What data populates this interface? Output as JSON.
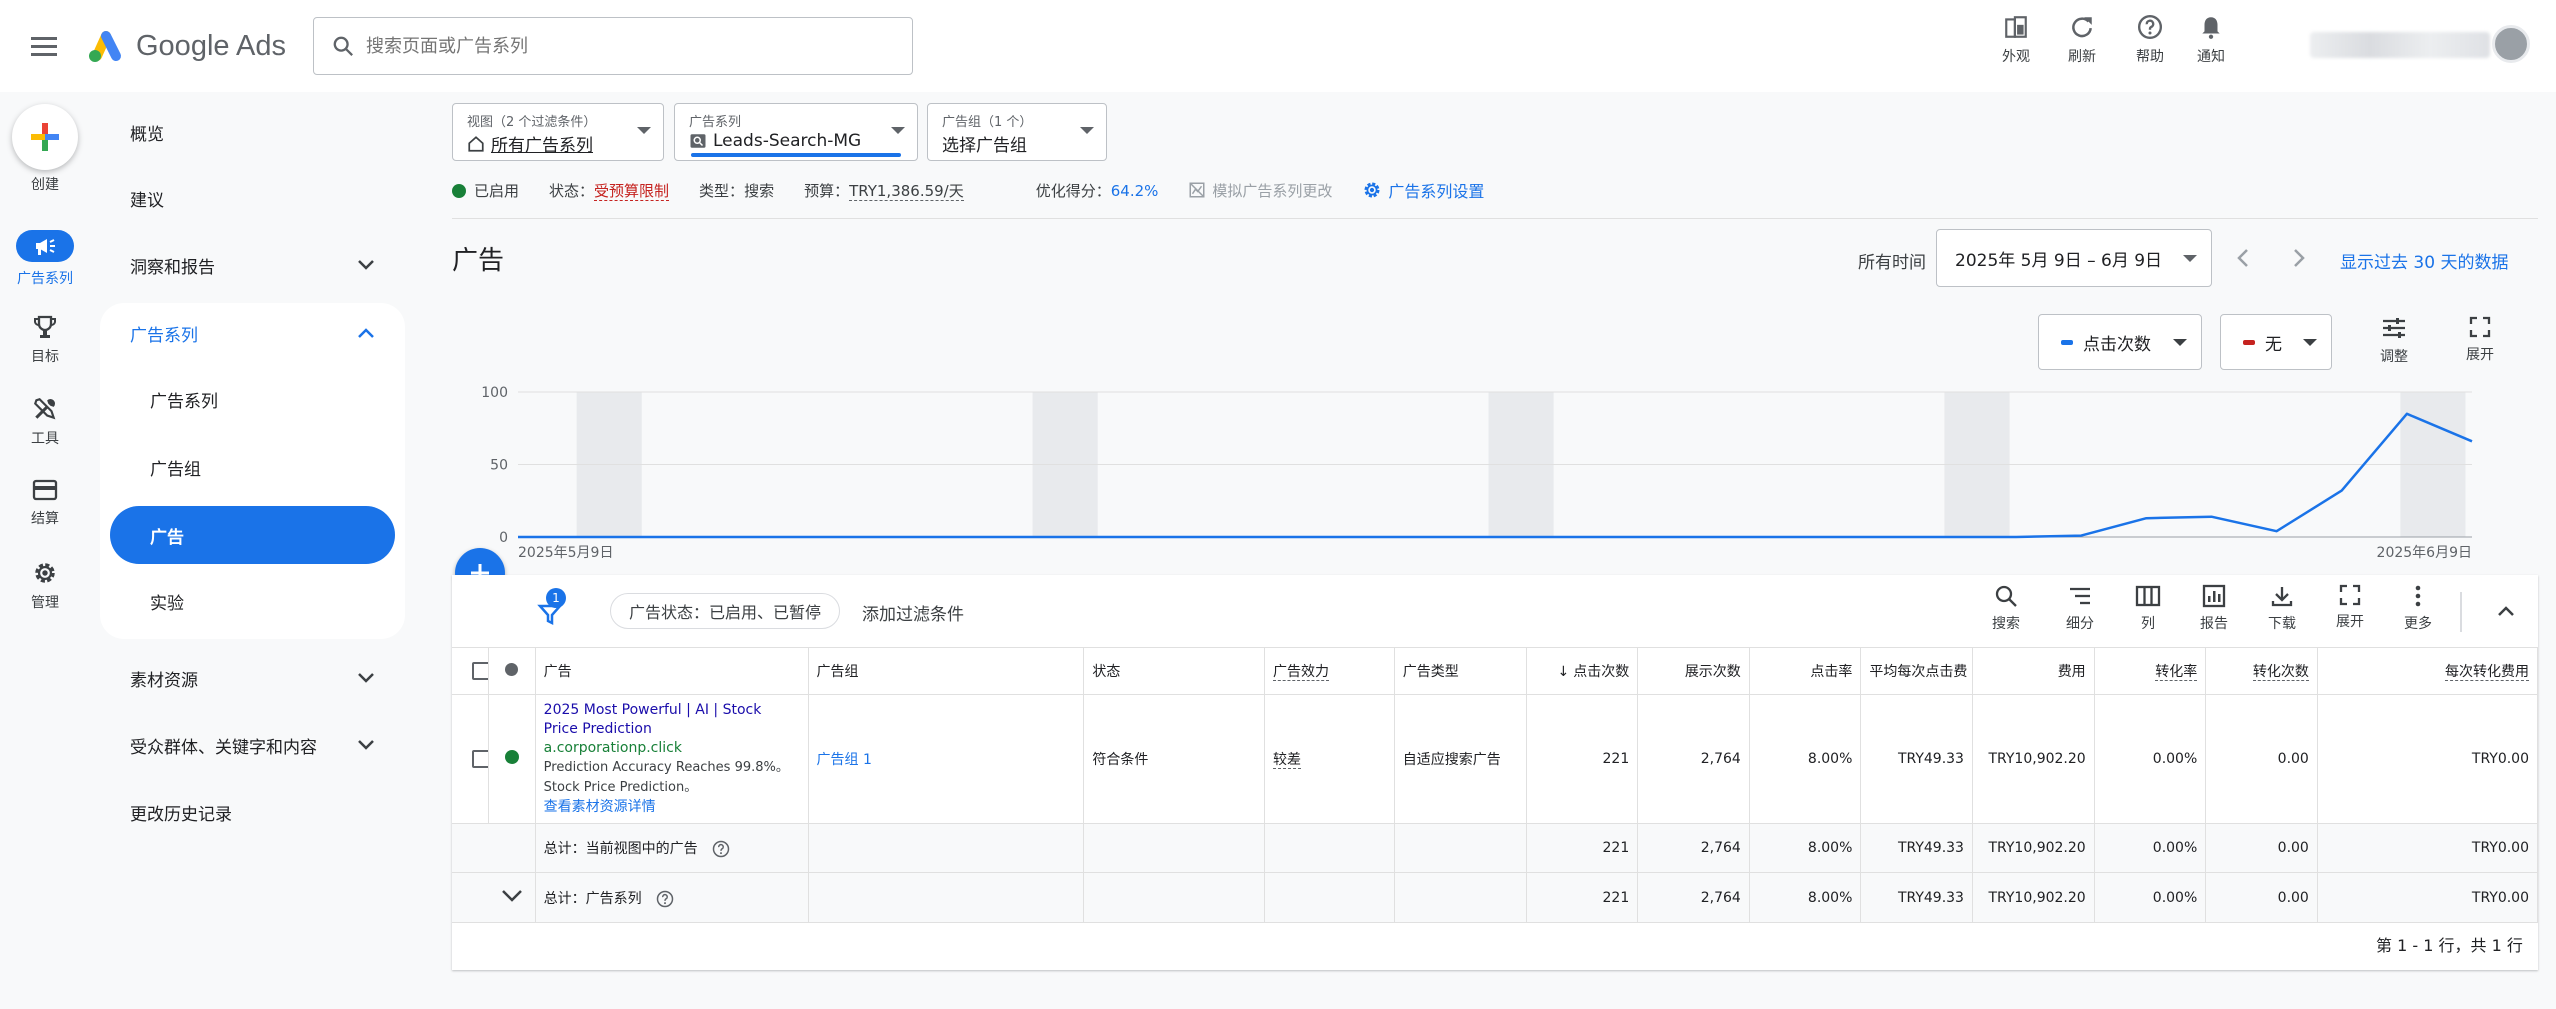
{
  "app": {
    "name": "Google Ads"
  },
  "search": {
    "placeholder": "搜索页面或广告系列"
  },
  "toolbar": {
    "appearance": "外观",
    "refresh": "刷新",
    "help": "帮助",
    "notifications": "通知"
  },
  "rail": {
    "create": "创建",
    "campaigns": "广告系列",
    "goals": "目标",
    "tools": "工具",
    "billing": "结算",
    "admin": "管理"
  },
  "nav": {
    "overview": "概览",
    "recommendations": "建议",
    "insights": "洞察和报告",
    "campaigns_group": "广告系列",
    "sub": {
      "campaigns": "广告系列",
      "ad_groups": "广告组",
      "ads": "广告",
      "experiments": "实验"
    },
    "assets": "素材资源",
    "audiences": "受众群体、关键字和内容",
    "change_history": "更改历史记录"
  },
  "selectors": {
    "view": {
      "label": "视图（2 个过滤条件）",
      "value": "所有广告系列"
    },
    "campaign": {
      "label": "广告系列",
      "value": "Leads-Search-MG"
    },
    "ad_group": {
      "label": "广告组（1 个）",
      "value": "选择广告组"
    }
  },
  "status_row": {
    "enabled": "已启用",
    "status_label": "状态：",
    "status_value": "受预算限制",
    "type_label": "类型：",
    "type_value": "搜索",
    "budget_label": "预算：",
    "budget_value": "TRY1,386.59/天",
    "opt_label": "优化得分：",
    "opt_value": "64.2%",
    "simulate": "模拟广告系列更改",
    "settings": "广告系列设置"
  },
  "page": {
    "title": "广告"
  },
  "date": {
    "all_time": "所有时间",
    "range": "2025年 5月 9日 – 6月 9日",
    "last30": "显示过去 30 天的数据"
  },
  "chart_controls": {
    "metric1": "点击次数",
    "metric2": "无",
    "adjust": "调整",
    "expand": "展开"
  },
  "colors": {
    "metric1": "#1a73e8",
    "metric2": "#c5221f",
    "accent": "#1a73e8"
  },
  "chart_data": {
    "type": "line",
    "series": [
      {
        "values": [
          0,
          0,
          0,
          0,
          0,
          0,
          0,
          0,
          0,
          0,
          0,
          0,
          0,
          0,
          0,
          0,
          0,
          0,
          0,
          0,
          0,
          0,
          0,
          0,
          1,
          13,
          14,
          4,
          32,
          85,
          66
        ]
      }
    ],
    "yticks": [
      0,
      50,
      100
    ],
    "ylim": [
      0,
      100
    ],
    "x_labels": [
      "2025年5月9日",
      "2025年6月9日"
    ],
    "weekend_shading": true
  },
  "table_toolbar": {
    "filter_count": "1",
    "filter_chip": "广告状态：已启用、已暂停",
    "add_filter": "添加过滤条件",
    "search": "搜索",
    "segment": "细分",
    "columns": "列",
    "reports": "报告",
    "download": "下载",
    "expand": "展开",
    "more": "更多"
  },
  "table": {
    "headers": {
      "ad": "广告",
      "ad_group": "广告组",
      "status": "状态",
      "ad_strength": "广告效力",
      "ad_type": "广告类型",
      "clicks": "点击次数",
      "impressions": "展示次数",
      "ctr": "点击率",
      "avg_cpc": "平均每次点击费",
      "cost": "费用",
      "conv_rate": "转化率",
      "conversions": "转化次数",
      "cost_per_conv": "每次转化费用"
    },
    "row": {
      "title": "2025 Most Powerful | AI | Stock Price Prediction",
      "url": "a.corporationp.click",
      "desc": "Prediction Accuracy Reaches 99.8%。Stock Price Prediction。",
      "view_assets": "查看素材资源详情",
      "ad_group": "广告组 1",
      "status": "符合条件",
      "ad_strength": "较差",
      "ad_type": "自适应搜索广告",
      "clicks": "221",
      "impressions": "2,764",
      "ctr": "8.00%",
      "avg_cpc": "TRY49.33",
      "cost": "TRY10,902.20",
      "conv_rate": "0.00%",
      "conversions": "0.00",
      "cost_per_conv": "TRY0.00"
    },
    "total_view": {
      "label": "总计：当前视图中的广告",
      "clicks": "221",
      "impressions": "2,764",
      "ctr": "8.00%",
      "avg_cpc": "TRY49.33",
      "cost": "TRY10,902.20",
      "conv_rate": "0.00%",
      "conversions": "0.00",
      "cost_per_conv": "TRY0.00"
    },
    "total_campaign": {
      "label": "总计：广告系列",
      "clicks": "221",
      "impressions": "2,764",
      "ctr": "8.00%",
      "avg_cpc": "TRY49.33",
      "cost": "TRY10,902.20",
      "conv_rate": "0.00%",
      "conversions": "0.00",
      "cost_per_conv": "TRY0.00"
    },
    "pagination": "第 1 - 1 行，共 1 行"
  }
}
